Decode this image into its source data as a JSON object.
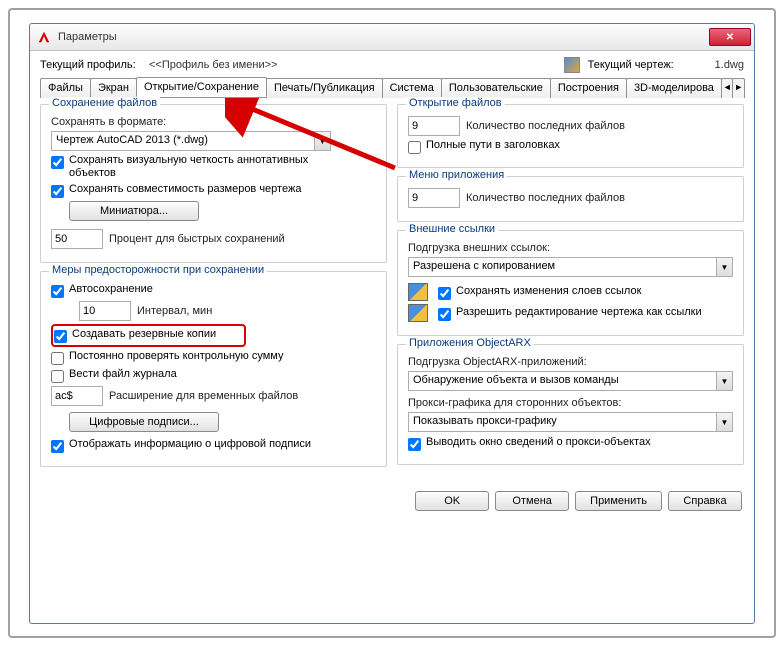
{
  "window": {
    "title": "Параметры"
  },
  "profile": {
    "label": "Текущий профиль:",
    "value": "<<Профиль без имени>>",
    "drawing_label": "Текущий чертеж:",
    "drawing_value": "1.dwg"
  },
  "tabs": [
    "Файлы",
    "Экран",
    "Открытие/Сохранение",
    "Печать/Публикация",
    "Система",
    "Пользовательские",
    "Построения",
    "3D-моделирова"
  ],
  "left": {
    "save_group": "Сохранение файлов",
    "save_as_label": "Сохранять в формате:",
    "save_as_value": "Чертеж AutoCAD 2013 (*.dwg)",
    "chk_vis": "Сохранять визуальную четкость аннотативных объектов",
    "chk_dim": "Сохранять совместимость размеров чертежа",
    "thumb_btn": "Миниатюра...",
    "fast_save_val": "50",
    "fast_save_lbl": "Процент для быстрых сохранений",
    "safety_group": "Меры предосторожности при сохранении",
    "chk_autosave": "Автосохранение",
    "interval_val": "10",
    "interval_lbl": "Интервал, мин",
    "chk_backup": "Создавать резервные копии",
    "chk_crc": "Постоянно проверять контрольную сумму",
    "chk_log": "Вести файл журнала",
    "ext_val": "ac$",
    "ext_lbl": "Расширение для временных файлов",
    "sig_btn": "Цифровые подписи...",
    "chk_sig_info": "Отображать информацию о цифровой подписи"
  },
  "right": {
    "open_group": "Открытие файлов",
    "recent_val": "9",
    "recent_lbl": "Количество последних файлов",
    "chk_fullpath": "Полные пути в заголовках",
    "appmenu_group": "Меню приложения",
    "appmenu_val": "9",
    "appmenu_lbl": "Количество последних файлов",
    "xref_group": "Внешние ссылки",
    "xref_load_lbl": "Подгрузка внешних ссылок:",
    "xref_load_val": "Разрешена с копированием",
    "chk_xref_layers": "Сохранять изменения слоев ссылок",
    "chk_xref_edit": "Разрешить редактирование чертежа как ссылки",
    "arx_group": "Приложения ObjectARX",
    "arx_load_lbl": "Подгрузка ObjectARX-приложений:",
    "arx_load_val": "Обнаружение объекта и вызов команды",
    "proxy_gfx_lbl": "Прокси-графика для сторонних объектов:",
    "proxy_gfx_val": "Показывать прокси-графику",
    "chk_proxy_info": "Выводить окно сведений о прокси-объектах"
  },
  "buttons": {
    "ok": "OK",
    "cancel": "Отмена",
    "apply": "Применить",
    "help": "Справка"
  }
}
